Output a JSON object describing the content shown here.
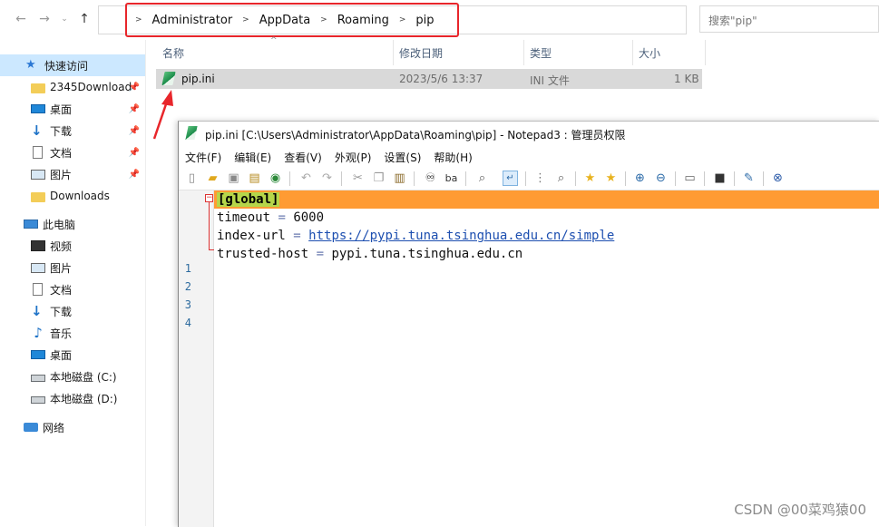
{
  "explorer": {
    "breadcrumb": [
      "Administrator",
      "AppData",
      "Roaming",
      "pip"
    ],
    "search_placeholder": "搜索\"pip\"",
    "sidebar": {
      "quick_access": "快速访问",
      "quick_items": [
        {
          "label": "2345Download",
          "icon": "folder-icon",
          "pinned": true
        },
        {
          "label": "桌面",
          "icon": "desktop-icon",
          "pinned": true
        },
        {
          "label": "下载",
          "icon": "download-icon",
          "pinned": true
        },
        {
          "label": "文档",
          "icon": "document-icon",
          "pinned": true
        },
        {
          "label": "图片",
          "icon": "picture-icon",
          "pinned": true
        },
        {
          "label": "Downloads",
          "icon": "folder-icon",
          "pinned": false
        }
      ],
      "this_pc": "此电脑",
      "pc_items": [
        {
          "label": "视频",
          "icon": "video-icon"
        },
        {
          "label": "图片",
          "icon": "picture-icon"
        },
        {
          "label": "文档",
          "icon": "document-icon"
        },
        {
          "label": "下载",
          "icon": "download-icon"
        },
        {
          "label": "音乐",
          "icon": "music-icon"
        },
        {
          "label": "桌面",
          "icon": "desktop-icon"
        },
        {
          "label": "本地磁盘 (C:)",
          "icon": "drive-icon"
        },
        {
          "label": "本地磁盘 (D:)",
          "icon": "drive-icon"
        }
      ],
      "network": "网络"
    },
    "columns": {
      "name": "名称",
      "modified": "修改日期",
      "type": "类型",
      "size": "大小"
    },
    "file": {
      "name": "pip.ini",
      "modified": "2023/5/6 13:37",
      "type": "INI 文件",
      "size": "1 KB"
    }
  },
  "notepad": {
    "title": "pip.ini [C:\\Users\\Administrator\\AppData\\Roaming\\pip] - Notepad3 : 管理员权限",
    "menu": [
      "文件(F)",
      "编辑(E)",
      "查看(V)",
      "外观(P)",
      "设置(S)",
      "帮助(H)"
    ],
    "lines": [
      {
        "num": "1",
        "section": "[global]"
      },
      {
        "num": "2",
        "key": "timeout",
        "eq": " = ",
        "value": "6000"
      },
      {
        "num": "3",
        "key": "index-url",
        "eq": " = ",
        "value": "https://pypi.tuna.tsinghua.edu.cn/simple"
      },
      {
        "num": "4",
        "key": "trusted-host",
        "eq": " = ",
        "value": "pypi.tuna.tsinghua.edu.cn"
      }
    ]
  },
  "watermark": "CSDN @00菜鸡猿00",
  "colors": {
    "highlight_line": "#ff9b33",
    "section_bg": "#b5d64a",
    "annotation_red": "#e8262b",
    "selection": "#cce8ff"
  }
}
